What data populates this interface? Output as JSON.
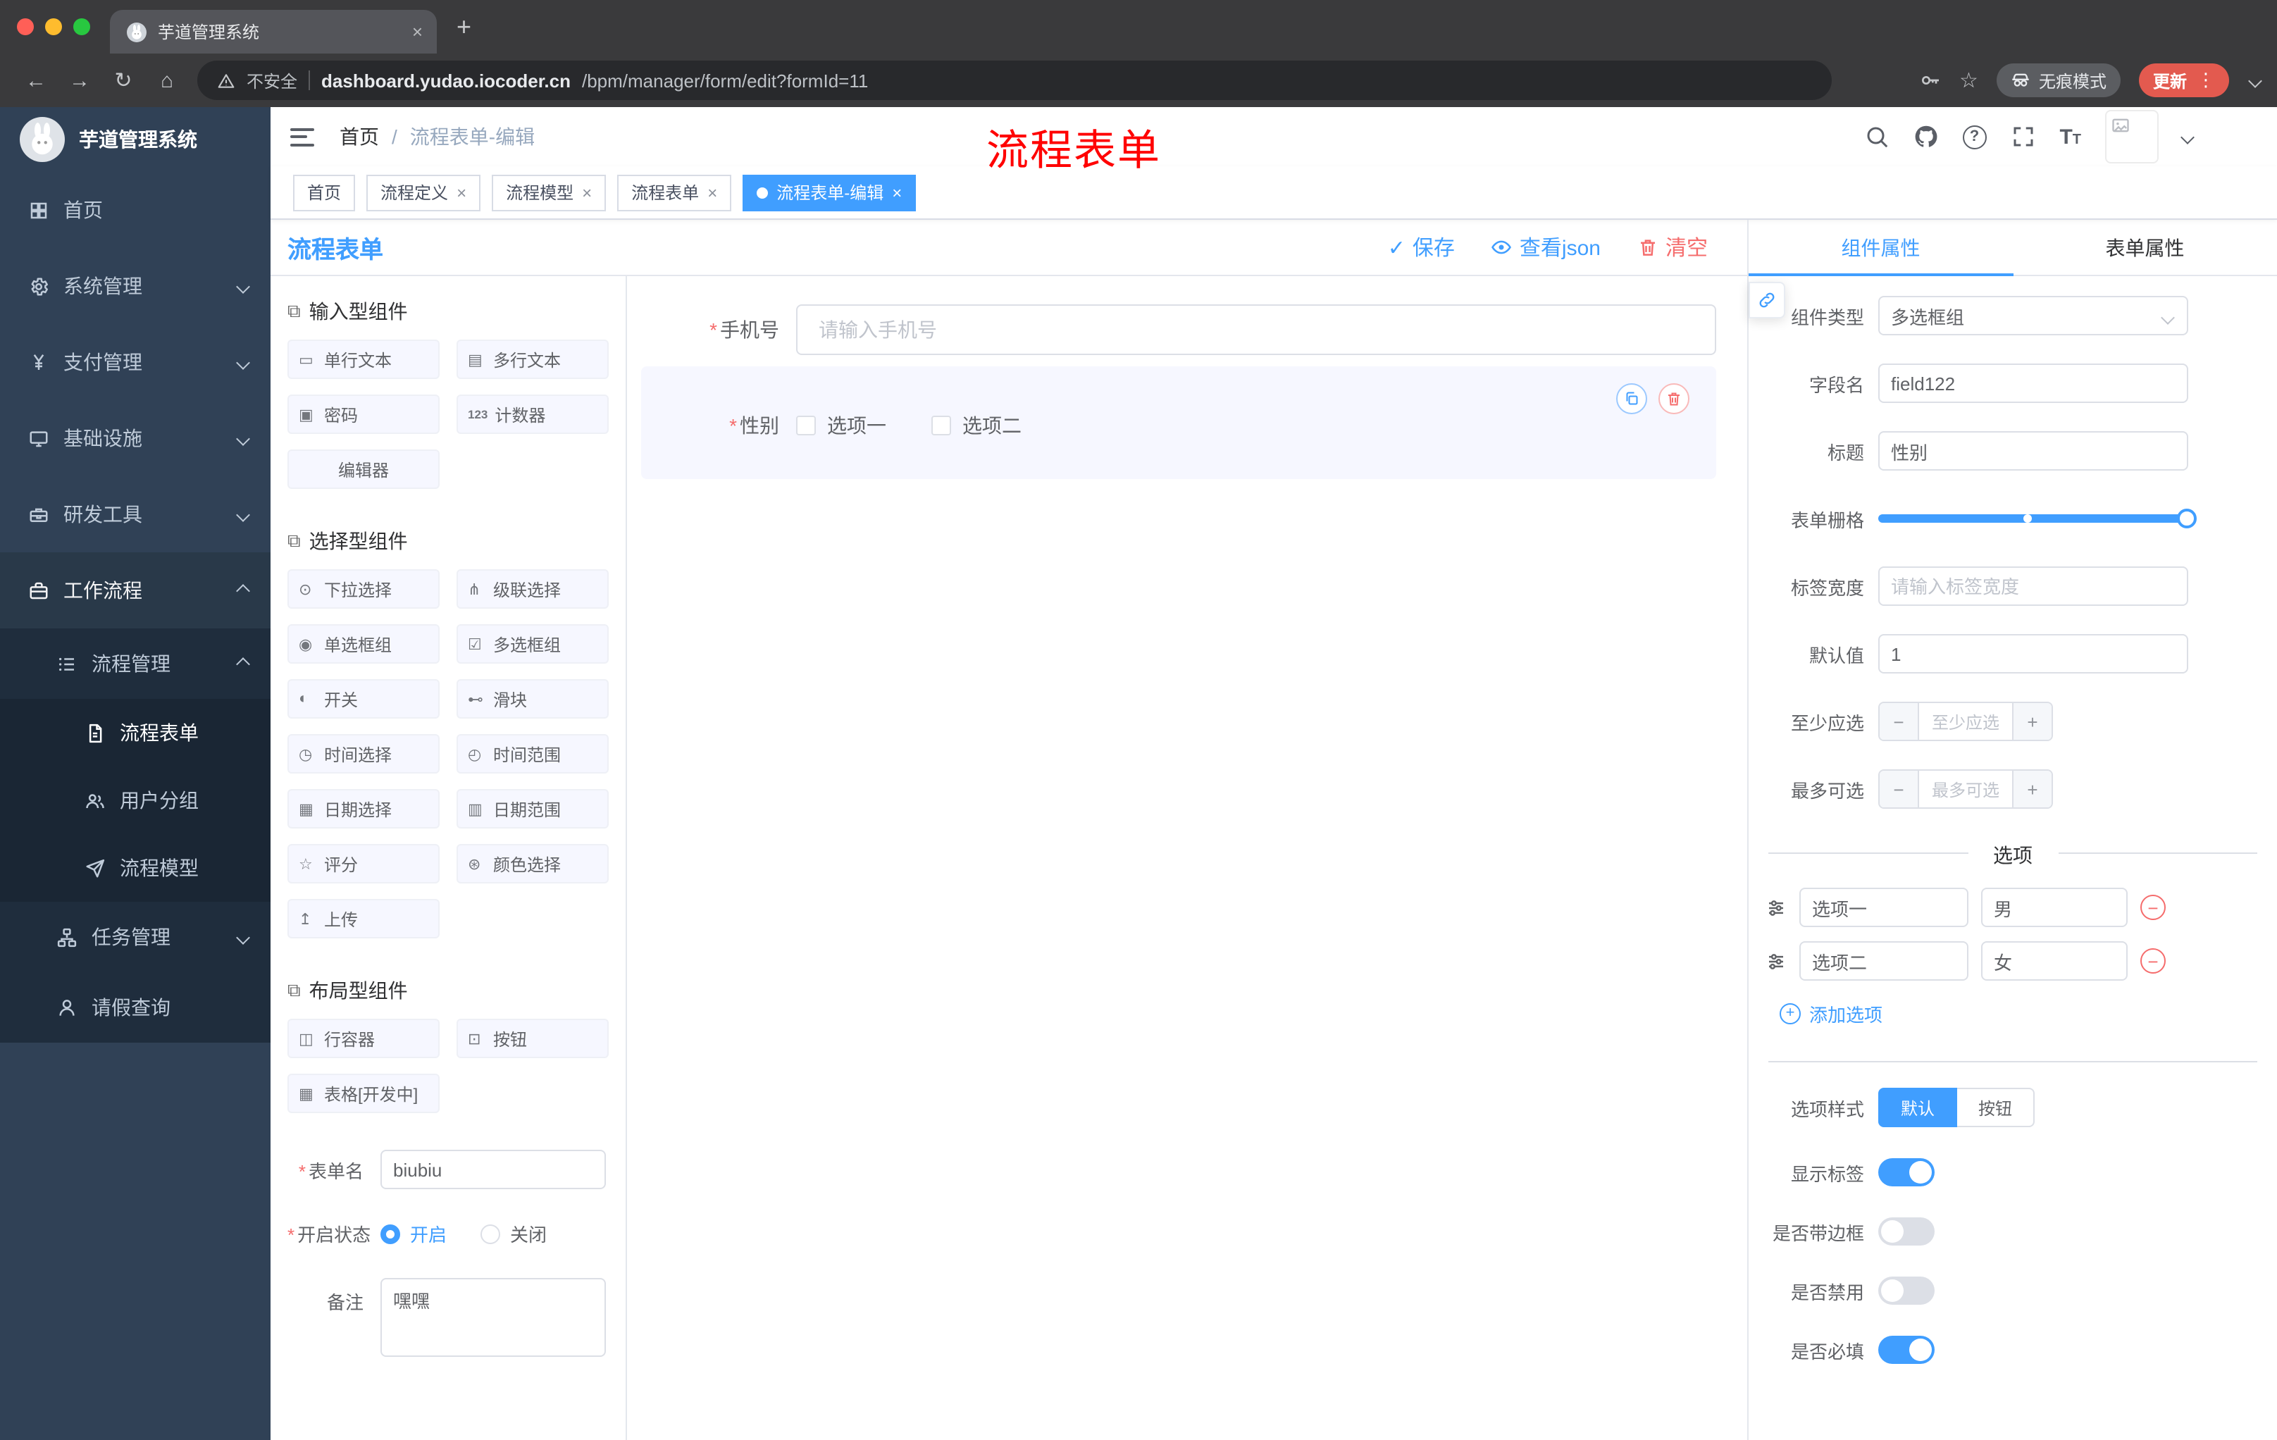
{
  "browser": {
    "tab_title": "芋道管理系统",
    "security_label": "不安全",
    "url_host": "dashboard.yudao.iocoder.cn",
    "url_path": "/bpm/manager/form/edit?formId=11",
    "incognito_label": "无痕模式",
    "update_label": "更新"
  },
  "annotation": {
    "text": "流程表单",
    "color": "#ff0000"
  },
  "sidebar": {
    "logo_title": "芋道管理系统",
    "menu": [
      {
        "label": "首页"
      },
      {
        "label": "系统管理"
      },
      {
        "label": "支付管理"
      },
      {
        "label": "基础设施"
      },
      {
        "label": "研发工具"
      },
      {
        "label": "工作流程"
      }
    ],
    "submenu": {
      "process_mgmt": "流程管理",
      "children": [
        "流程表单",
        "用户分组",
        "流程模型"
      ],
      "task_mgmt": "任务管理",
      "leave_query": "请假查询"
    }
  },
  "header": {
    "breadcrumb_home": "首页",
    "breadcrumb_current": "流程表单-编辑"
  },
  "tags": [
    {
      "label": "首页"
    },
    {
      "label": "流程定义"
    },
    {
      "label": "流程模型"
    },
    {
      "label": "流程表单"
    },
    {
      "label": "流程表单-编辑"
    }
  ],
  "designer": {
    "title": "流程表单",
    "save_label": "保存",
    "view_json_label": "查看json",
    "clear_label": "清空",
    "sections": [
      {
        "icon": "⧉",
        "title": "输入型组件",
        "items": [
          {
            "icon": "▭",
            "label": "单行文本"
          },
          {
            "icon": "▤",
            "label": "多行文本"
          },
          {
            "icon": "▣",
            "label": "密码"
          },
          {
            "icon": "123",
            "label": "计数器"
          },
          {
            "icon": "",
            "label": "编辑器"
          }
        ]
      },
      {
        "icon": "⧉",
        "title": "选择型组件",
        "items": [
          {
            "icon": "⊙",
            "label": "下拉选择"
          },
          {
            "icon": "⋔",
            "label": "级联选择"
          },
          {
            "icon": "◉",
            "label": "单选框组"
          },
          {
            "icon": "☑",
            "label": "多选框组"
          },
          {
            "icon": "◐",
            "label": "开关"
          },
          {
            "icon": "⊷",
            "label": "滑块"
          },
          {
            "icon": "◷",
            "label": "时间选择"
          },
          {
            "icon": "◴",
            "label": "时间范围"
          },
          {
            "icon": "▦",
            "label": "日期选择"
          },
          {
            "icon": "▥",
            "label": "日期范围"
          },
          {
            "icon": "☆",
            "label": "评分"
          },
          {
            "icon": "⊛",
            "label": "颜色选择"
          },
          {
            "icon": "↥",
            "label": "上传"
          }
        ]
      },
      {
        "icon": "⧉",
        "title": "布局型组件",
        "items": [
          {
            "icon": "◫",
            "label": "行容器"
          },
          {
            "icon": "⊡",
            "label": "按钮"
          },
          {
            "icon": "▦",
            "label": "表格[开发中]"
          }
        ]
      }
    ],
    "meta": {
      "form_name_label": "表单名",
      "form_name_value": "biubiu",
      "status_label": "开启状态",
      "status_on": "开启",
      "status_off": "关闭",
      "remark_label": "备注",
      "remark_value": "嘿嘿"
    }
  },
  "canvas": {
    "phone_label": "手机号",
    "phone_placeholder": "请输入手机号",
    "gender_label": "性别",
    "gender_options": [
      "选项一",
      "选项二"
    ]
  },
  "props": {
    "tab_component": "组件属性",
    "tab_form": "表单属性",
    "rows": {
      "type_label": "组件类型",
      "type_value": "多选框组",
      "field_label": "字段名",
      "field_value": "field122",
      "title_label": "标题",
      "title_value": "性别",
      "grid_label": "表单栅格",
      "label_width_label": "标签宽度",
      "label_width_placeholder": "请输入标签宽度",
      "default_label": "默认值",
      "default_value": "1",
      "min_label": "至少应选",
      "min_placeholder": "至少应选",
      "max_label": "最多可选",
      "max_placeholder": "最多可选"
    },
    "options_title": "选项",
    "options": [
      {
        "label": "选项一",
        "value": "男"
      },
      {
        "label": "选项二",
        "value": "女"
      }
    ],
    "add_option_label": "添加选项",
    "style_label": "选项样式",
    "style_default": "默认",
    "style_button": "按钮",
    "switches": [
      {
        "label": "显示标签",
        "on": true
      },
      {
        "label": "是否带边框",
        "on": false
      },
      {
        "label": "是否禁用",
        "on": false
      },
      {
        "label": "是否必填",
        "on": true
      }
    ]
  },
  "icons": {
    "close": "×",
    "plus": "+",
    "minus": "−",
    "back_arrow": "←",
    "forward_arrow": "→",
    "reload": "↻",
    "home": "⌂",
    "star": "☆",
    "overflow_menu": "⋮",
    "check": "✓",
    "question_mark": "?",
    "required_mark": "*",
    "breadcrumb_separator": "/",
    "font_size_large": "T",
    "font_size_small": "T"
  },
  "colors": {
    "primary": "#409eff",
    "danger": "#f56c6c",
    "annotation_red": "#ff0000",
    "sidebar_bg": "#304156",
    "submenu_bg": "#1f2d3d",
    "traffic_close": "#ff5f57",
    "traffic_minimize": "#febc2e",
    "traffic_maximize": "#28c840"
  }
}
